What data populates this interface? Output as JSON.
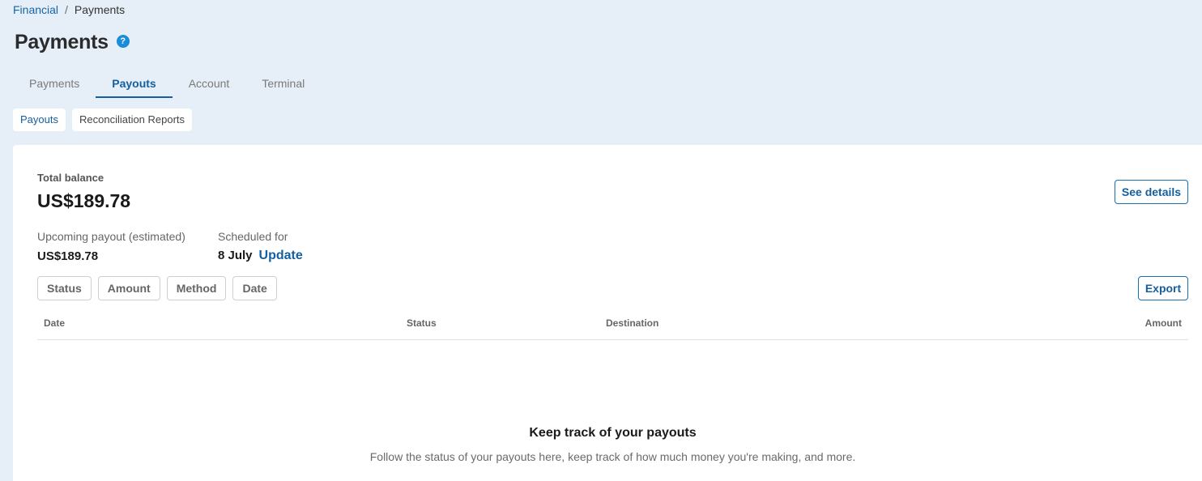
{
  "breadcrumb": {
    "parent": "Financial",
    "separator": "/",
    "current": "Payments"
  },
  "page": {
    "title": "Payments",
    "help_icon": "?"
  },
  "tabs": [
    {
      "label": "Payments",
      "active": false
    },
    {
      "label": "Payouts",
      "active": true
    },
    {
      "label": "Account",
      "active": false
    },
    {
      "label": "Terminal",
      "active": false
    }
  ],
  "subtabs": [
    {
      "label": "Payouts",
      "active": true
    },
    {
      "label": "Reconciliation Reports",
      "active": false
    }
  ],
  "balance": {
    "label": "Total balance",
    "value": "US$189.78",
    "see_details_label": "See details"
  },
  "upcoming": {
    "label": "Upcoming payout (estimated)",
    "value": "US$189.78"
  },
  "scheduled": {
    "label": "Scheduled for",
    "date": "8 July",
    "update_label": "Update"
  },
  "filters": [
    "Status",
    "Amount",
    "Method",
    "Date"
  ],
  "export_label": "Export",
  "table": {
    "columns": [
      "Date",
      "Status",
      "Destination",
      "Amount"
    ]
  },
  "empty_state": {
    "title": "Keep track of your payouts",
    "description": "Follow the status of your payouts here, keep track of how much money you're making, and more."
  },
  "colors": {
    "accent": "#155fa0",
    "background": "#e6eff7",
    "help_icon": "#1a8cd8"
  }
}
